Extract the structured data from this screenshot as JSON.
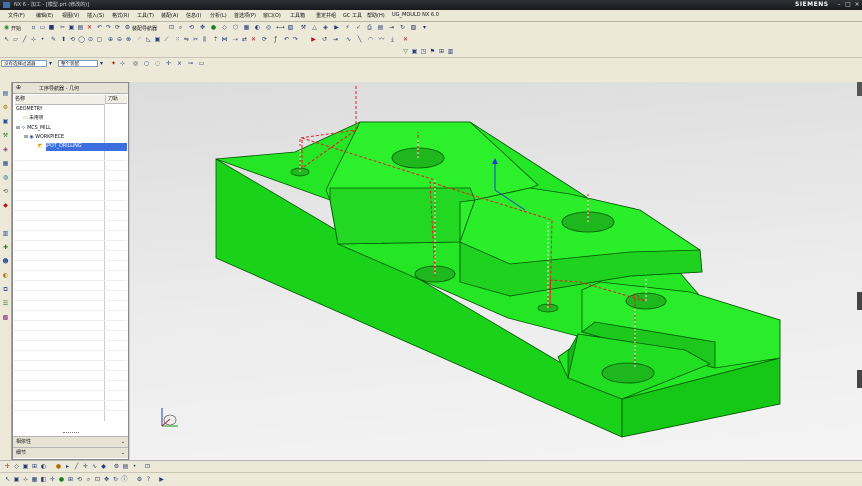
{
  "window": {
    "title": "NX 6 - 加工 - [模型.prt (修改的)]",
    "brand": "SIEMENS"
  },
  "menu": [
    "文件(F)",
    "编辑(E)",
    "视图(V)",
    "插入(S)",
    "格式(R)",
    "工具(T)",
    "装配(A)",
    "信息(I)",
    "分析(L)",
    "首选项(P)",
    "窗口(O)",
    "工具箱",
    "重定并组",
    "GC 工具",
    "帮助(H)",
    "UG_MOULD NX 6.0"
  ],
  "toolbar": {
    "start_label": "开始",
    "assembly_nav_label": "装配导航器",
    "filter_select": "没有选择过滤器",
    "assembly_select": "整个装配"
  },
  "navigator": {
    "title": "工序导航器 - 几何",
    "col_name": "名称",
    "col_tool": "刀轨",
    "items": [
      "GEOMETRY",
      "未用项",
      "MCS_MILL",
      "WORKPIECE",
      "SPOT_DRILLING"
    ],
    "section_1": "相依性",
    "section_2": "细节"
  }
}
